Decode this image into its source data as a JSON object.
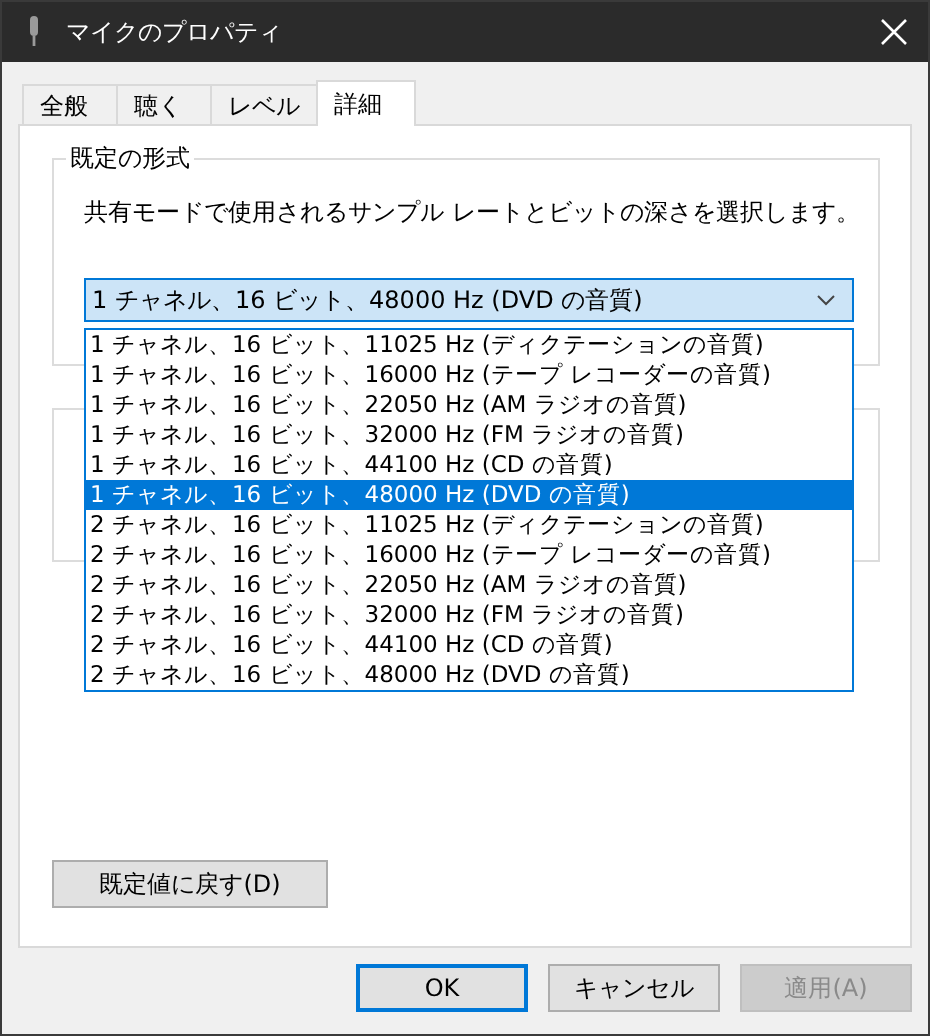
{
  "window": {
    "title": "マイクのプロパティ"
  },
  "tabs": [
    {
      "label": "全般",
      "selected": false
    },
    {
      "label": "聴く",
      "selected": false
    },
    {
      "label": "レベル",
      "selected": false
    },
    {
      "label": "詳細",
      "selected": true
    }
  ],
  "format_group": {
    "title": "既定の形式",
    "description": "共有モードで使用されるサンプル レートとビットの深さを選択します。",
    "combo": {
      "value": "1 チャネル、16 ビット、48000 Hz (DVD の音質)",
      "expanded": true
    },
    "options": [
      {
        "label": "1 チャネル、16 ビット、11025 Hz (ディクテーションの音質)",
        "selected": false
      },
      {
        "label": "1 チャネル、16 ビット、16000 Hz (テープ レコーダーの音質)",
        "selected": false
      },
      {
        "label": "1 チャネル、16 ビット、22050 Hz (AM ラジオの音質)",
        "selected": false
      },
      {
        "label": "1 チャネル、16 ビット、32000 Hz (FM ラジオの音質)",
        "selected": false
      },
      {
        "label": "1 チャネル、16 ビット、44100 Hz (CD の音質)",
        "selected": false
      },
      {
        "label": "1 チャネル、16 ビット、48000 Hz (DVD の音質)",
        "selected": true
      },
      {
        "label": "2 チャネル、16 ビット、11025 Hz (ディクテーションの音質)",
        "selected": false
      },
      {
        "label": "2 チャネル、16 ビット、16000 Hz (テープ レコーダーの音質)",
        "selected": false
      },
      {
        "label": "2 チャネル、16 ビット、22050 Hz (AM ラジオの音質)",
        "selected": false
      },
      {
        "label": "2 チャネル、16 ビット、32000 Hz (FM ラジオの音質)",
        "selected": false
      },
      {
        "label": "2 チャネル、16 ビット、44100 Hz (CD の音質)",
        "selected": false
      },
      {
        "label": "2 チャネル、16 ビット、48000 Hz (DVD の音質)",
        "selected": false
      }
    ]
  },
  "reset_button": "既定値に戻す(D)",
  "buttons": [
    {
      "label": "OK",
      "default": true,
      "disabled": false
    },
    {
      "label": "キャンセル",
      "default": false,
      "disabled": false
    },
    {
      "label": "適用(A)",
      "default": false,
      "disabled": true
    }
  ]
}
